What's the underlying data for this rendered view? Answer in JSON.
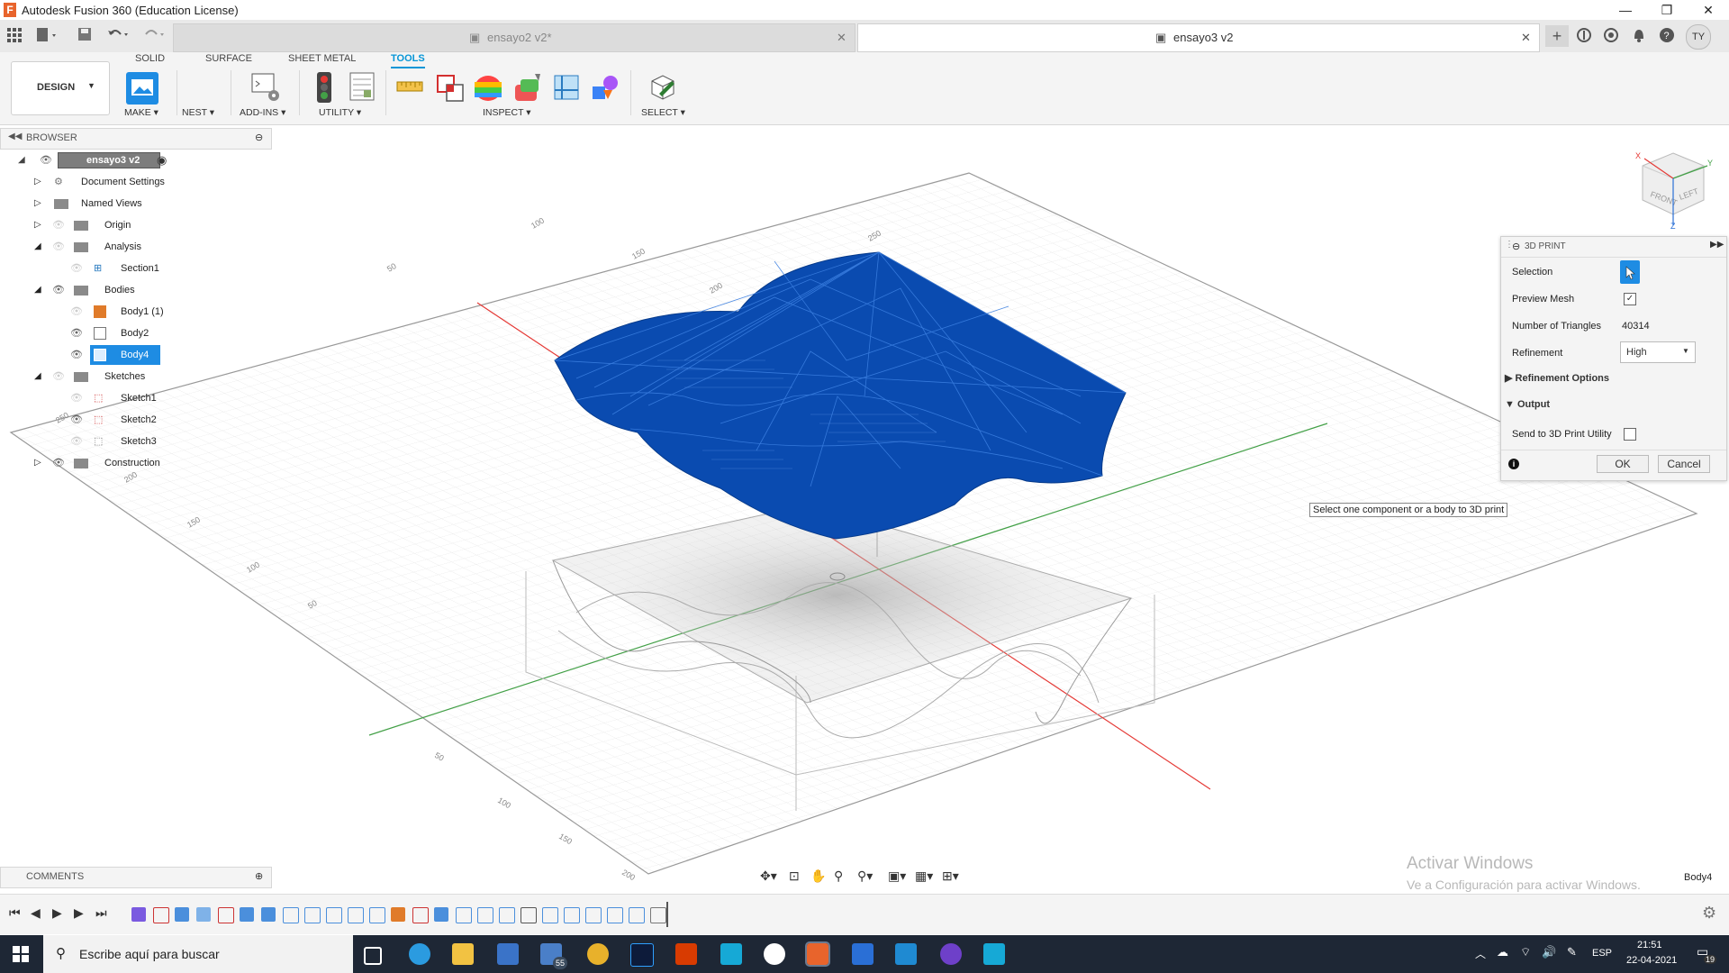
{
  "window": {
    "title": "Autodesk Fusion 360 (Education License)"
  },
  "tabs": [
    {
      "label": "ensayo2 v2*"
    },
    {
      "label": "ensayo3 v2"
    }
  ],
  "user_initials": "TY",
  "ribbon": {
    "workspace": "DESIGN",
    "tabs": [
      "SOLID",
      "SURFACE",
      "SHEET METAL",
      "TOOLS"
    ],
    "active_tab": "TOOLS",
    "groups": [
      "MAKE",
      "NEST",
      "ADD-INS",
      "UTILITY",
      "INSPECT",
      "SELECT"
    ]
  },
  "browser": {
    "title": "BROWSER",
    "root": "ensayo3 v2",
    "items": [
      {
        "label": "Document Settings"
      },
      {
        "label": "Named Views"
      },
      {
        "label": "Origin"
      },
      {
        "label": "Analysis"
      },
      {
        "label": "Section1"
      },
      {
        "label": "Bodies"
      },
      {
        "label": "Body1 (1)"
      },
      {
        "label": "Body2"
      },
      {
        "label": "Body4"
      },
      {
        "label": "Sketches"
      },
      {
        "label": "Sketch1"
      },
      {
        "label": "Sketch2"
      },
      {
        "label": "Sketch3"
      },
      {
        "label": "Construction"
      }
    ]
  },
  "comments": {
    "title": "COMMENTS"
  },
  "print_panel": {
    "title": "3D PRINT",
    "selection_label": "Selection",
    "preview_label": "Preview Mesh",
    "triangles_label": "Number of Triangles",
    "triangles_value": "40314",
    "refinement_label": "Refinement",
    "refinement_value": "High",
    "refinement_options": "Refinement Options",
    "output": "Output",
    "send_label": "Send to 3D Print Utility",
    "ok": "OK",
    "cancel": "Cancel"
  },
  "tooltip": "Select one component or a body to 3D print",
  "axis_ticks": {
    "left": [
      "250",
      "200",
      "150",
      "100",
      "50"
    ],
    "bottom": [
      "50",
      "100",
      "150",
      "200"
    ],
    "top": [
      "50",
      "100",
      "150",
      "200",
      "250"
    ]
  },
  "watermark": {
    "line1": "Activar Windows",
    "line2": "Ve a Configuración para activar Windows."
  },
  "status_body": "Body4",
  "taskbar": {
    "search_placeholder": "Escribe aquí para buscar",
    "mail_badge": "55",
    "lang": "ESP",
    "time": "21:51",
    "date": "22-04-2021",
    "notif": "19"
  },
  "colors": {
    "accent": "#0696d7",
    "mesh": "#0a4bb0",
    "selection": "#1e8ce3"
  }
}
